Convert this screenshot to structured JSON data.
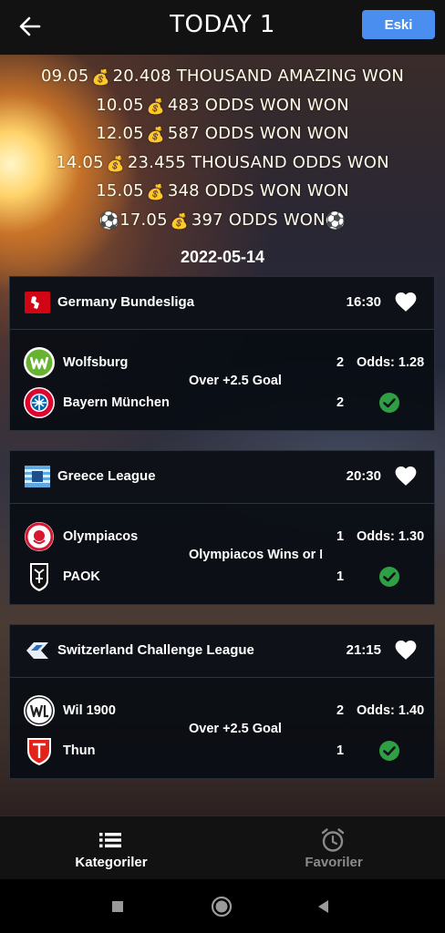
{
  "appbar": {
    "title": "TODAY 1",
    "old_button": "Eski",
    "back_icon": "arrow-left-icon"
  },
  "results": [
    {
      "date": "09.05",
      "text": "20.408 THOUSAND AMAZING WON",
      "prefix_ball": false,
      "suffix_ball": false
    },
    {
      "date": "10.05",
      "text": "483 ODDS WON WON",
      "prefix_ball": false,
      "suffix_ball": false
    },
    {
      "date": "12.05",
      "text": "587 ODDS WON WON",
      "prefix_ball": false,
      "suffix_ball": false
    },
    {
      "date": "14.05",
      "text": "23.455 THOUSAND ODDS WON",
      "prefix_ball": false,
      "suffix_ball": false
    },
    {
      "date": "15.05",
      "text": "348 ODDS WON WON",
      "prefix_ball": false,
      "suffix_ball": false
    },
    {
      "date": "17.05",
      "text": "397 ODDS WON",
      "prefix_ball": true,
      "suffix_ball": true
    }
  ],
  "date_header": "2022-05-14",
  "matches": [
    {
      "league": "Germany Bundesliga",
      "time": "16:30",
      "home": {
        "name": "Wolfsburg",
        "score": "2"
      },
      "away": {
        "name": "Bayern München",
        "score": "2"
      },
      "pick": "Over +2.5 Goal",
      "odds": "Odds: 1.28",
      "status": "won"
    },
    {
      "league": "Greece League",
      "time": "20:30",
      "home": {
        "name": "Olympiacos",
        "score": "1"
      },
      "away": {
        "name": "PAOK",
        "score": "1"
      },
      "pick": "Olympiacos Wins or D",
      "odds": "Odds: 1.30",
      "status": "won"
    },
    {
      "league": "Switzerland Challenge League",
      "time": "21:15",
      "home": {
        "name": "Wil 1900",
        "score": "2"
      },
      "away": {
        "name": "Thun",
        "score": "1"
      },
      "pick": "Over +2.5 Goal",
      "odds": "Odds: 1.40",
      "status": "won"
    }
  ],
  "bottom_nav": {
    "categories": "Kategoriler",
    "favorites": "Favoriler"
  },
  "colors": {
    "accent": "#4a8ff0",
    "won_check": "#2ea043",
    "card_bg": "#0e1218",
    "inactive_nav": "#8a8a8a"
  }
}
